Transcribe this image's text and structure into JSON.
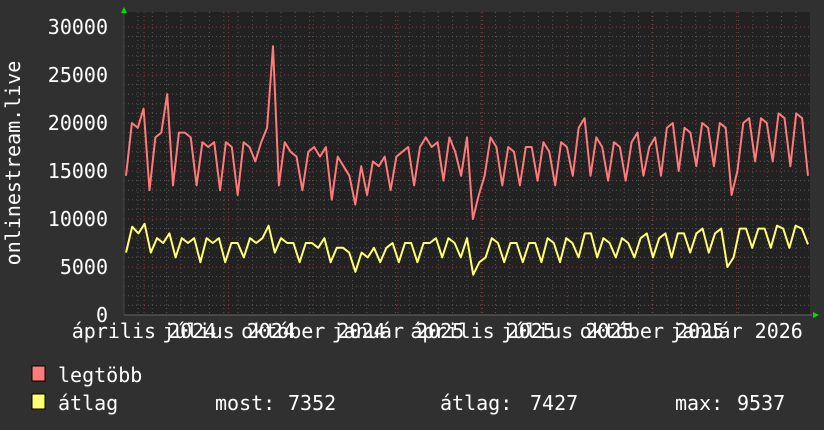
{
  "chart_data": {
    "type": "line",
    "ylabel": "onlinestream.live",
    "ylim": [
      0,
      30000
    ],
    "y_ticks": [
      "0",
      "5000",
      "10000",
      "15000",
      "20000",
      "25000",
      "30000"
    ],
    "x_ticks": [
      "április 2024",
      "július 2024",
      "október 2024",
      "január 2025",
      "április 2025",
      "július 2025",
      "október 2025",
      "január 2026"
    ],
    "grid": true,
    "legend_position": "bottom-left",
    "series": [
      {
        "name": "legtöbb",
        "color": "#ff7a7a",
        "values": [
          14500,
          20000,
          19500,
          21500,
          13000,
          18500,
          19000,
          23000,
          13500,
          19000,
          19000,
          18500,
          13500,
          18000,
          17500,
          18000,
          13000,
          18000,
          17500,
          12500,
          18000,
          17500,
          16000,
          18000,
          19500,
          28000,
          13500,
          18000,
          17000,
          16500,
          13000,
          17000,
          17500,
          16500,
          17500,
          12000,
          16500,
          15500,
          14500,
          11500,
          15500,
          12500,
          16000,
          15500,
          16500,
          13000,
          16500,
          17000,
          17500,
          13500,
          17500,
          18500,
          17500,
          18000,
          14000,
          18500,
          17000,
          14500,
          18500,
          10000,
          12500,
          14500,
          18500,
          17500,
          13500,
          17500,
          17000,
          13500,
          17500,
          17500,
          14000,
          18000,
          17000,
          13500,
          18000,
          17500,
          14500,
          19500,
          20500,
          14500,
          18500,
          17500,
          14000,
          18000,
          17500,
          14000,
          18000,
          19000,
          14500,
          17500,
          18500,
          14500,
          19500,
          20000,
          15000,
          19500,
          19000,
          15500,
          20000,
          19500,
          15500,
          20000,
          19500,
          12500,
          15000,
          20000,
          20500,
          16000,
          20500,
          20000,
          16000,
          21000,
          20500,
          15500,
          21000,
          20500,
          14500
        ]
      },
      {
        "name": "átlag",
        "color": "#ffff70",
        "values": [
          6500,
          9200,
          8500,
          9500,
          6500,
          8000,
          7500,
          8500,
          6000,
          8000,
          7500,
          8000,
          5500,
          8000,
          7500,
          8000,
          5500,
          7500,
          7500,
          6000,
          8000,
          7500,
          8000,
          9300,
          6500,
          8000,
          7500,
          7500,
          5500,
          7500,
          7500,
          7000,
          8000,
          5500,
          7000,
          7000,
          6500,
          4500,
          6500,
          6000,
          7000,
          5500,
          7000,
          7500,
          5500,
          7500,
          7500,
          5500,
          7500,
          7500,
          8000,
          6000,
          8000,
          7500,
          6000,
          8000,
          4200,
          5500,
          6000,
          8000,
          7500,
          5500,
          7500,
          7500,
          5500,
          7500,
          7500,
          5500,
          8000,
          7500,
          5500,
          8000,
          7500,
          6000,
          8500,
          8500,
          6000,
          8000,
          7500,
          6000,
          8000,
          7500,
          6000,
          8000,
          8500,
          6000,
          8000,
          8500,
          6000,
          8500,
          8500,
          6500,
          8500,
          9000,
          6500,
          8500,
          9000,
          5000,
          6000,
          9000,
          9000,
          7000,
          9000,
          9000,
          7000,
          9300,
          9000,
          7000,
          9300,
          9000,
          7352
        ]
      }
    ],
    "legend": [
      {
        "name": "legtöbb",
        "color": "#ff7a7a"
      },
      {
        "name": "átlag",
        "color": "#ffff70",
        "stats": {
          "now_label": "most:",
          "now": "7352",
          "avg_label": "átlag:",
          "avg": "7427",
          "max_label": "max:",
          "max": "9537"
        }
      }
    ]
  }
}
